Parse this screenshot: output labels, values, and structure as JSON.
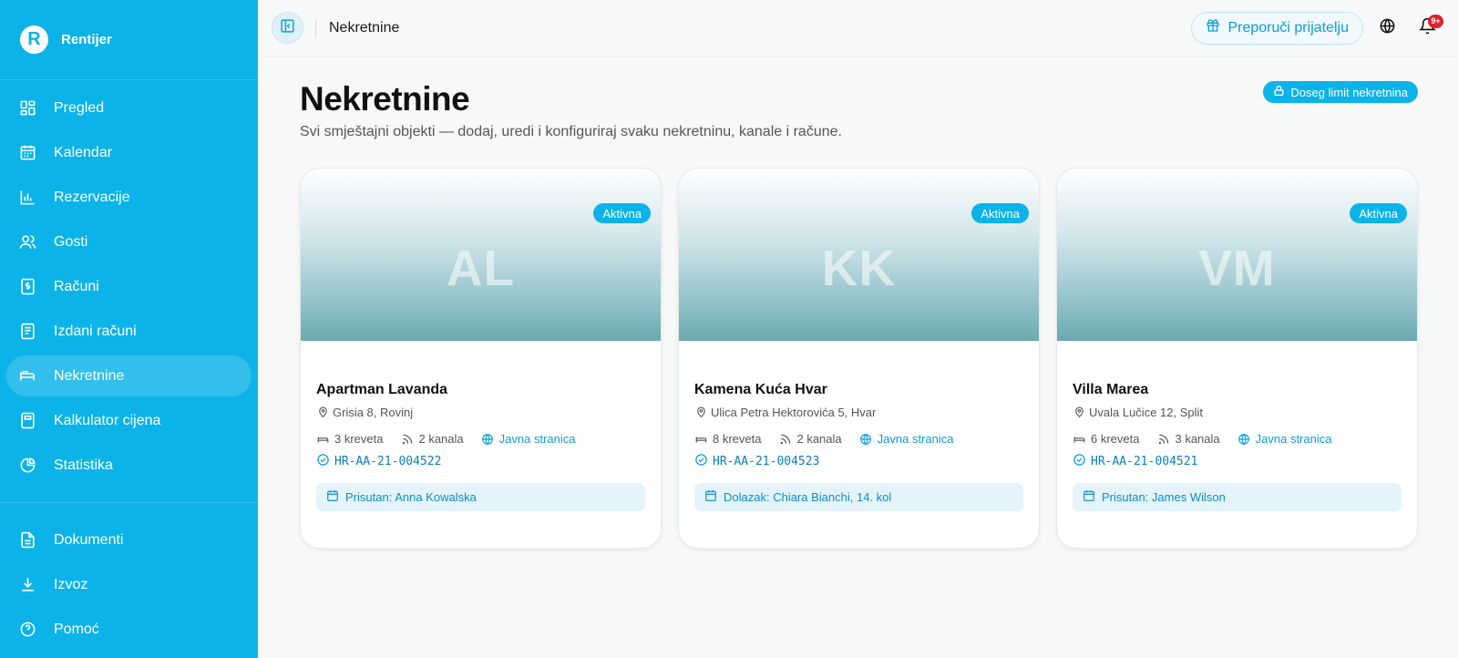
{
  "brand": {
    "logo_letter": "R",
    "name": "Rentijer"
  },
  "sidebar": {
    "items": [
      {
        "id": "pregled",
        "label": "Pregled",
        "icon": "dashboard-icon"
      },
      {
        "id": "kalendar",
        "label": "Kalendar",
        "icon": "calendar-icon"
      },
      {
        "id": "rezervacije",
        "label": "Rezervacije",
        "icon": "bar-chart-icon"
      },
      {
        "id": "gosti",
        "label": "Gosti",
        "icon": "users-icon"
      },
      {
        "id": "racuni",
        "label": "Računi",
        "icon": "invoice-dollar-icon"
      },
      {
        "id": "izdani-racuni",
        "label": "Izdani računi",
        "icon": "receipt-icon"
      },
      {
        "id": "nekretnine",
        "label": "Nekretnine",
        "icon": "bed-icon",
        "active": true
      },
      {
        "id": "kalkulator-cijena",
        "label": "Kalkulator cijena",
        "icon": "calculator-icon"
      },
      {
        "id": "statistika",
        "label": "Statistika",
        "icon": "pie-chart-icon"
      }
    ],
    "bottom_items": [
      {
        "id": "dokumenti",
        "label": "Dokumenti",
        "icon": "document-icon"
      },
      {
        "id": "izvoz",
        "label": "Izvoz",
        "icon": "download-icon"
      },
      {
        "id": "pomoc",
        "label": "Pomoć",
        "icon": "help-circle-icon"
      }
    ]
  },
  "topbar": {
    "title": "Nekretnine",
    "refer_label": "Preporuči prijatelju",
    "notifications_badge": "9+"
  },
  "main": {
    "title": "Nekretnine",
    "subtitle": "Svi smještajni objekti — dodaj, uredi i konfiguriraj svaku nekretninu, kanale i račune.",
    "limit_label": "Doseg limit nekretnina"
  },
  "properties": [
    {
      "initials": "AL",
      "status": "Aktivna",
      "name": "Apartman Lavanda",
      "address": "Grisia 8, Rovinj",
      "beds": "3 kreveta",
      "channels": "2 kanala",
      "public_page": "Javna stranica",
      "license": "HR-AA-21-004522",
      "guest_status": "Prisutan: Anna Kowalska"
    },
    {
      "initials": "KK",
      "status": "Aktivna",
      "name": "Kamena Kuća Hvar",
      "address": "Ulica Petra Hektorovića 5, Hvar",
      "beds": "8 kreveta",
      "channels": "2 kanala",
      "public_page": "Javna stranica",
      "license": "HR-AA-21-004523",
      "guest_status": "Dolazak: Chiara Bianchi, 14. kol"
    },
    {
      "initials": "VM",
      "status": "Aktivna",
      "name": "Villa Marea",
      "address": "Uvala Lučice 12, Split",
      "beds": "6 kreveta",
      "channels": "3 kanala",
      "public_page": "Javna stranica",
      "license": "HR-AA-21-004521",
      "guest_status": "Prisutan: James Wilson"
    }
  ],
  "colors": {
    "accent": "#0bb3e8",
    "link": "#0a9ed6",
    "badge_red": "#e0202a"
  }
}
